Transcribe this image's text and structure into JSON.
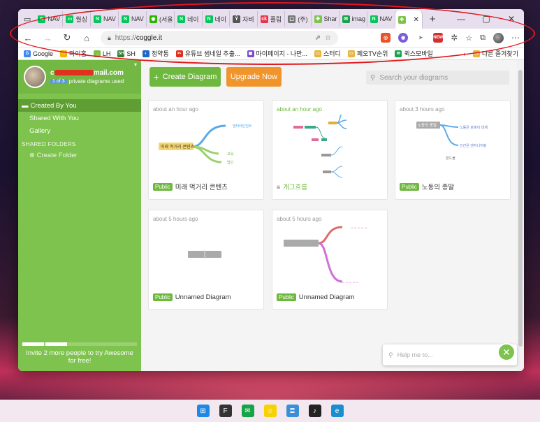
{
  "browser": {
    "tabs": [
      {
        "label": "NAV",
        "icon": "naver-icon",
        "color": "#03c75a",
        "glyph": "N"
      },
      {
        "label": "월싱",
        "icon": "chat-icon",
        "color": "#03c75a",
        "glyph": "▭"
      },
      {
        "label": "NAV",
        "icon": "naver-icon",
        "color": "#03c75a",
        "glyph": "N"
      },
      {
        "label": "NAV",
        "icon": "naver-icon",
        "color": "#03c75a",
        "glyph": "N"
      },
      {
        "label": "(서울",
        "icon": "map-icon",
        "color": "#2db400",
        "glyph": "◉"
      },
      {
        "label": "네이",
        "icon": "naver-icon",
        "color": "#03c75a",
        "glyph": "N"
      },
      {
        "label": "네이",
        "icon": "naver-icon",
        "color": "#03c75a",
        "glyph": "N"
      },
      {
        "label": "자비",
        "icon": "person-icon",
        "color": "#555555",
        "glyph": "Ŷ"
      },
      {
        "label": "플립",
        "icon": "ck-icon",
        "color": "#e8344a",
        "glyph": "ck"
      },
      {
        "label": "(주)",
        "icon": "document-icon",
        "color": "#777777",
        "glyph": "▢"
      },
      {
        "label": "Shar",
        "icon": "coggle-icon",
        "color": "#7ec34d",
        "glyph": "✚"
      },
      {
        "label": "imag",
        "icon": "mail-icon",
        "color": "#16a34a",
        "glyph": "✉"
      },
      {
        "label": "NAV",
        "icon": "naver-icon",
        "color": "#03c75a",
        "glyph": "N"
      }
    ],
    "active_tab": {
      "label": "",
      "icon": "coggle-icon",
      "color": "#7ec34d"
    },
    "new_tab": "+",
    "window_controls": {
      "minimize": "—",
      "maximize": "▢",
      "close": "✕"
    },
    "url_scheme": "https://",
    "url_host": "coggle.it",
    "bookmarks": [
      {
        "label": "Google",
        "color": "#4285f4",
        "glyph": "G"
      },
      {
        "label": "마이홈",
        "color": "#f5b400",
        "glyph": "⌂"
      },
      {
        "label": "LH",
        "color": "#7ac143",
        "glyph": "→"
      },
      {
        "label": "SH",
        "color": "#2e7d32",
        "glyph": "SH"
      },
      {
        "label": "정약통",
        "color": "#1e66c8",
        "glyph": "◐"
      },
      {
        "label": "유튜브 썸네일 추출...",
        "color": "#e0301e",
        "glyph": "✂"
      },
      {
        "label": "마이페이지 - 나만...",
        "color": "#7a4cc8",
        "glyph": "▦"
      },
      {
        "label": "스터디",
        "color": "#e8b53a",
        "glyph": "▭"
      },
      {
        "label": "페오TV순위",
        "color": "#e8b53a",
        "glyph": "▭"
      },
      {
        "label": "퀵스모바일",
        "color": "#16a34a",
        "glyph": "✉"
      }
    ],
    "bookmarks_more": "다른 즐겨찾기"
  },
  "sidebar": {
    "email_prefix": "c",
    "email_suffix": "mail.com",
    "usage_count": "1 of 3",
    "usage_text": "private diagrams used",
    "menu_active": "Created By You",
    "menu_items": [
      "Shared With You",
      "Gallery"
    ],
    "shared_folders_title": "SHARED FOLDERS",
    "create_folder": "Create Folder",
    "invite_line1": "Invite 2 more people to try Awesome",
    "invite_line2": "for free!",
    "invite_progress": 0.4
  },
  "main": {
    "create_button": "Create Diagram",
    "upgrade_button": "Upgrade Now",
    "search_placeholder": "Search your diagrams",
    "help_placeholder": "Help me to...",
    "cards": [
      {
        "time": "about an hour ago",
        "badge": "Public",
        "title": "미래 먹거리 콘텐츠",
        "root": "미래 먹거리 콘텐츠",
        "nodes": [
          "엔터테인먼트",
          "교육",
          "법인"
        ]
      },
      {
        "time": "about an hour ago",
        "badge": "",
        "title": "개그흐름"
      },
      {
        "time": "about 3 hours ago",
        "badge": "Public",
        "title": "노동의 종말",
        "root": "노동의 종말",
        "nodes": [
          "노동은 로봇이 대체",
          "인간은 엔지니어링",
          "편드불"
        ]
      },
      {
        "time": "about 5 hours ago",
        "badge": "Public",
        "title": "Unnamed Diagram"
      },
      {
        "time": "about 5 hours ago",
        "badge": "Public",
        "title": "Unnamed Diagram"
      }
    ]
  },
  "taskbar": [
    {
      "name": "windows-start-icon",
      "color": "#1e88e5",
      "glyph": "⊞"
    },
    {
      "name": "app-icon",
      "color": "#333333",
      "glyph": "F"
    },
    {
      "name": "mail-icon",
      "color": "#16a34a",
      "glyph": "✉"
    },
    {
      "name": "kakaotalk-icon",
      "color": "#f7d100",
      "glyph": "☺"
    },
    {
      "name": "notepad-icon",
      "color": "#3a8fd6",
      "glyph": "≣"
    },
    {
      "name": "music-icon",
      "color": "#222222",
      "glyph": "♪"
    },
    {
      "name": "edge-icon",
      "color": "#1a8fd0",
      "glyph": "e"
    }
  ]
}
